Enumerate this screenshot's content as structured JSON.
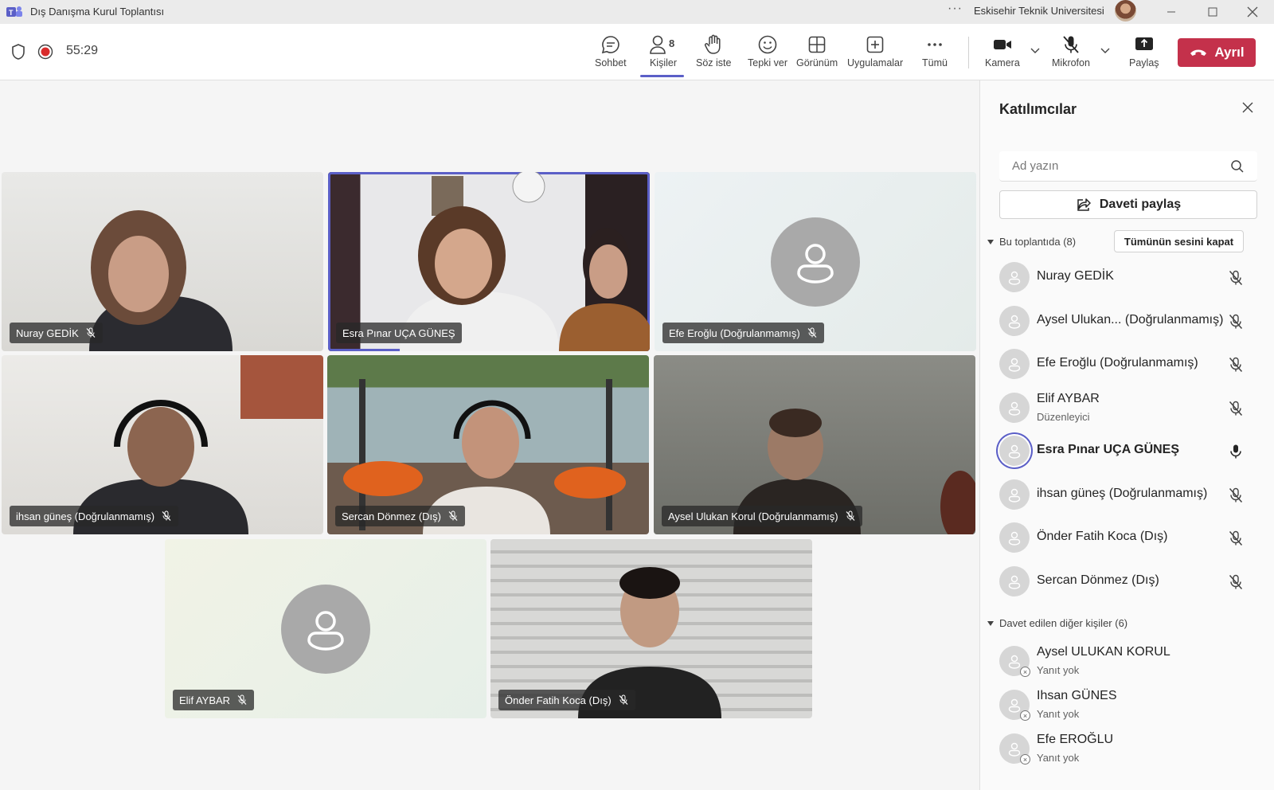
{
  "window": {
    "title": "Dış Danışma Kurul Toplantısı",
    "more": "···",
    "organization": "Eskisehir Teknik Universitesi"
  },
  "meeting": {
    "timer": "55:29"
  },
  "toolbar": {
    "chat": "Sohbet",
    "people": "Kişiler",
    "people_count": "8",
    "raise_hand": "Söz iste",
    "react": "Tepki ver",
    "view": "Görünüm",
    "apps": "Uygulamalar",
    "more": "Tümü",
    "camera": "Kamera",
    "mic": "Mikrofon",
    "share": "Paylaş",
    "leave": "Ayrıl"
  },
  "tiles": [
    {
      "name": "Nuray GEDİK"
    },
    {
      "name": "Esra Pınar UÇA GÜNEŞ"
    },
    {
      "name": "Efe Eroğlu (Doğrulanmamış)"
    },
    {
      "name": "ihsan güneş (Doğrulanmamış)"
    },
    {
      "name": "Sercan Dönmez (Dış)"
    },
    {
      "name": "Aysel Ulukan Korul (Doğrulanmamış)"
    },
    {
      "name": "Elif AYBAR"
    },
    {
      "name": "Önder Fatih Koca (Dış)"
    }
  ],
  "panel": {
    "title": "Katılımcılar",
    "search_placeholder": "Ad yazın",
    "invite": "Daveti paylaş",
    "in_meeting_header": "Bu toplantıda (8)",
    "mute_all": "Tümünün sesini kapat",
    "participants": [
      {
        "name": "Nuray GEDİK",
        "role": ""
      },
      {
        "name": "Aysel Ulukan... (Doğrulanmamış)",
        "role": ""
      },
      {
        "name": "Efe Eroğlu (Doğrulanmamış)",
        "role": ""
      },
      {
        "name": "Elif AYBAR",
        "role": "Düzenleyici"
      },
      {
        "name": "Esra Pınar UÇA GÜNEŞ",
        "role": ""
      },
      {
        "name": "ihsan güneş (Doğrulanmamış)",
        "role": ""
      },
      {
        "name": "Önder Fatih Koca (Dış)",
        "role": ""
      },
      {
        "name": "Sercan Dönmez (Dış)",
        "role": ""
      }
    ],
    "invited_header": "Davet edilen diğer kişiler (6)",
    "invited": [
      {
        "name": "Aysel ULUKAN KORUL",
        "status": "Yanıt yok"
      },
      {
        "name": "Ihsan GÜNES",
        "status": "Yanıt yok"
      },
      {
        "name": "Efe EROĞLU",
        "status": "Yanıt yok"
      }
    ]
  },
  "colors": {
    "accent": "#5b5fc7",
    "leave": "#c4314b",
    "record": "#d92c2c"
  }
}
